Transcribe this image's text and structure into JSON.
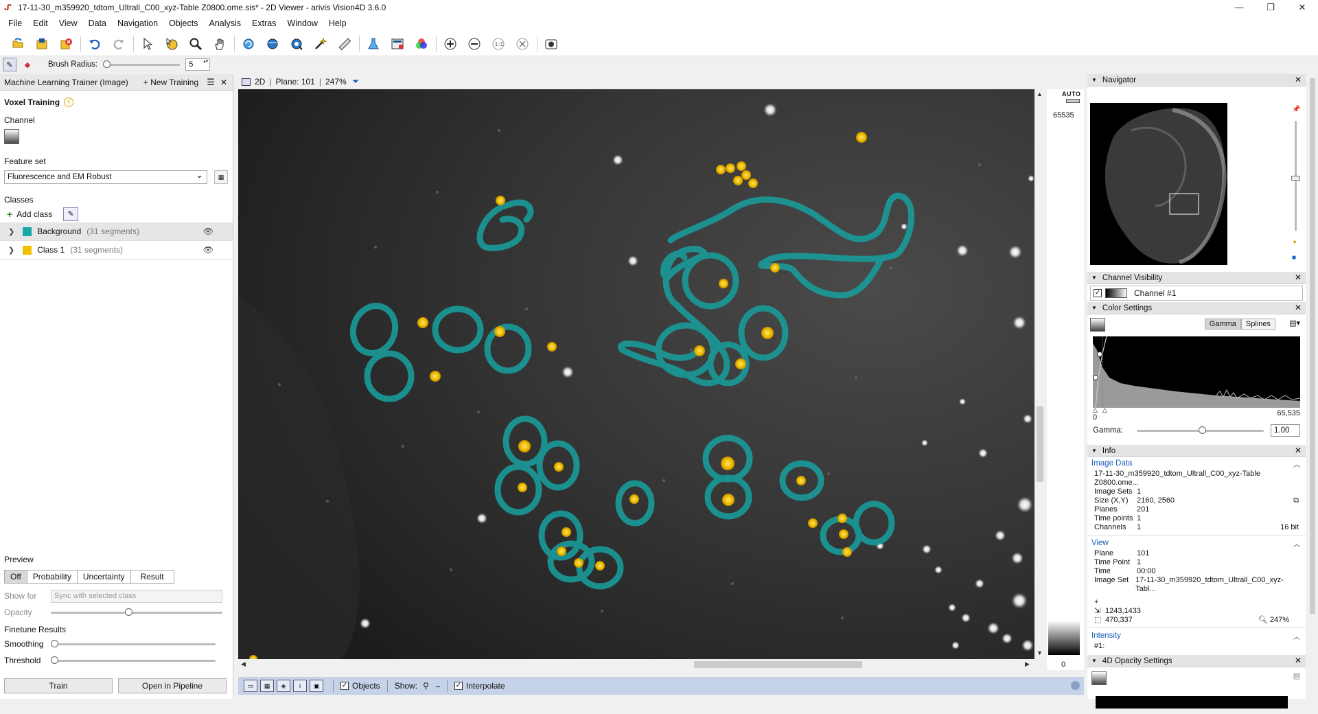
{
  "window": {
    "title": "17-11-30_m359920_tdtom_Ultrall_C00_xyz-Table Z0800.ome.sis* - 2D Viewer - arivis Vision4D 3.6.0",
    "controls": [
      "—",
      "❐",
      "✕"
    ]
  },
  "menu": [
    "File",
    "Edit",
    "View",
    "Data",
    "Navigation",
    "Objects",
    "Analysis",
    "Extras",
    "Window",
    "Help"
  ],
  "brush": {
    "label": "Brush Radius:",
    "value": "5",
    "level": 0
  },
  "left_panel": {
    "title": "Machine Learning Trainer (Image)",
    "new_training": "+ New Training",
    "section": "Voxel Training",
    "channel_label": "Channel",
    "feature_set_label": "Feature set",
    "feature_set_value": "Fluorescence and EM Robust",
    "classes_label": "Classes",
    "add_class": "Add class",
    "classes": [
      {
        "name": "Background",
        "segments": "(31 segments)",
        "color": "#17a8a8"
      },
      {
        "name": "Class 1",
        "segments": "(31 segments)",
        "color": "#f0c000"
      }
    ],
    "preview": {
      "label": "Preview",
      "modes": [
        "Off",
        "Probability",
        "Uncertainty",
        "Result"
      ],
      "active_mode": "Off",
      "show_for_label": "Show for",
      "show_for_value": "Sync with selected class",
      "opacity_label": "Opacity",
      "opacity_level": 0.45,
      "finetune_label": "Finetune Results",
      "smoothing_label": "Smoothing",
      "threshold_label": "Threshold"
    },
    "train_button": "Train",
    "pipeline_button": "Open in Pipeline"
  },
  "viewer": {
    "mode": "2D",
    "plane": "Plane: 101",
    "zoom": "247%",
    "intensity_auto": "AUTO",
    "intensity_max": "65535",
    "intensity_min": "0",
    "footer": {
      "objects_label": "Objects",
      "show_label": "Show:",
      "interpolate_label": "Interpolate"
    }
  },
  "right_panel": {
    "navigator_title": "Navigator",
    "channel_visibility_title": "Channel Visibility",
    "channel_name": "Channel #1",
    "color_settings_title": "Color Settings",
    "gamma_btn": "Gamma",
    "splines_btn": "Splines",
    "histo_min": "0",
    "histo_max": "65,535",
    "gamma_label": "Gamma:",
    "gamma_value": "1.00",
    "info_title": "Info",
    "image_data_title": "Image Data",
    "image_data_file": "17-11-30_m359920_tdtom_Ultrall_C00_xyz-Table Z0800.ome...",
    "image_data": [
      {
        "k": "Image Sets",
        "v": "1",
        "r": ""
      },
      {
        "k": "Size (X,Y)",
        "v": "2160, 2560",
        "r": ""
      },
      {
        "k": "Planes",
        "v": "201",
        "r": ""
      },
      {
        "k": "Time points",
        "v": "1",
        "r": ""
      },
      {
        "k": "Channels",
        "v": "1",
        "r": "16 bit"
      }
    ],
    "view_title": "View",
    "view_data": [
      {
        "k": "Plane",
        "v": "101"
      },
      {
        "k": "Time Point",
        "v": "1"
      },
      {
        "k": "Time",
        "v": "00:00"
      },
      {
        "k": "Image Set",
        "v": "17-11-30_m359920_tdtom_Ultrall_C00_xyz-Tabl..."
      }
    ],
    "cursor_pos": "1243,1433",
    "cursor_size": "470,337",
    "zoom": "247%",
    "intensity_title": "Intensity",
    "intensity_channel": "#1:",
    "opacity_title": "4D Opacity Settings"
  }
}
